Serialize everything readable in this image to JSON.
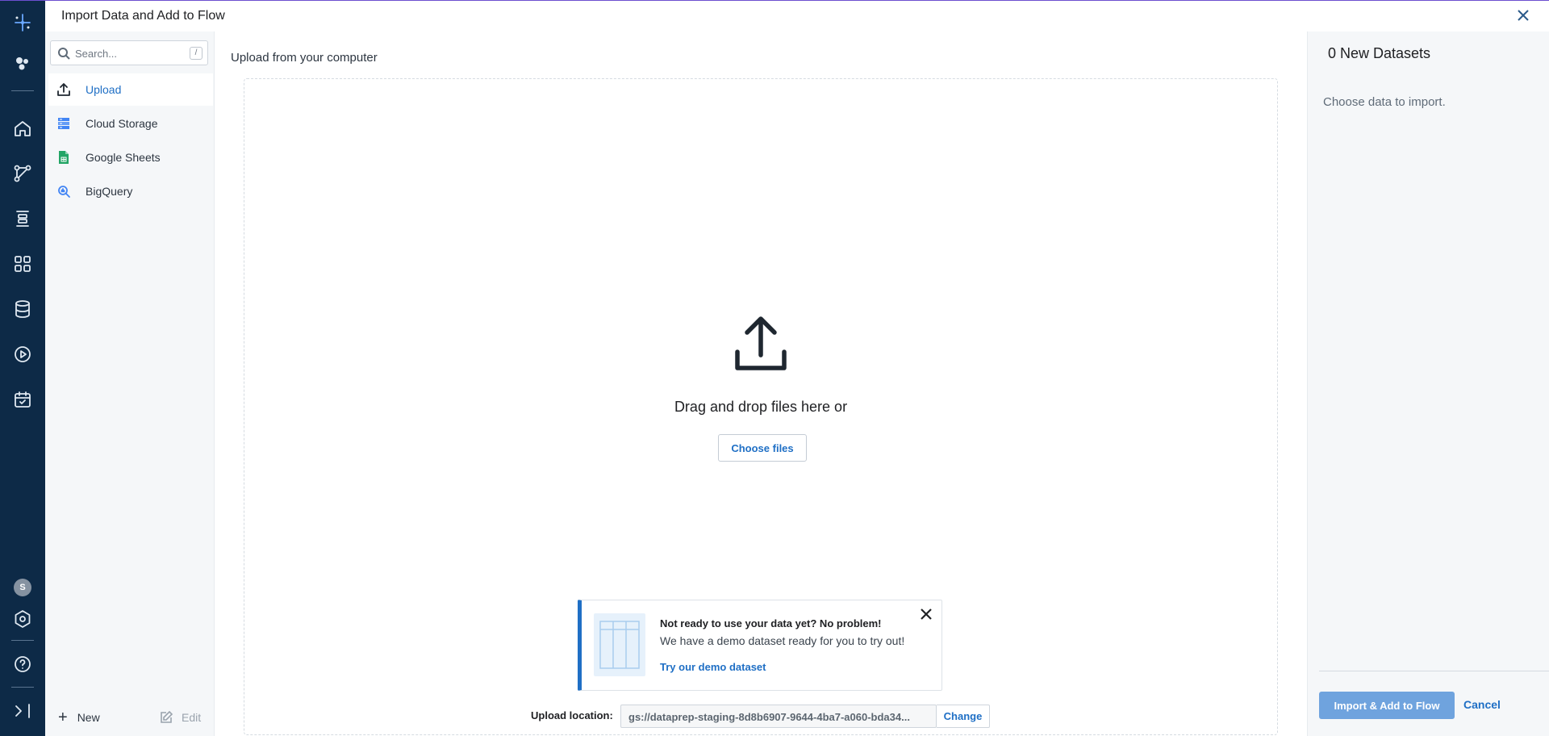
{
  "window": {
    "title": "Import Data and Add to Flow",
    "close_icon": "close-icon"
  },
  "rail": {
    "avatar_initial": "S",
    "icons": [
      "flows-logo-icon",
      "recipes-icon",
      "home-icon",
      "flows-icon",
      "plans-icon",
      "apps-icon",
      "datasets-icon",
      "jobs-icon",
      "schedules-icon",
      "settings-icon",
      "help-icon",
      "expand-icon"
    ]
  },
  "sidebar": {
    "search_placeholder": "Search...",
    "search_shortcut": "/",
    "items": [
      {
        "label": "Upload",
        "icon": "upload-icon",
        "active": true
      },
      {
        "label": "Cloud Storage",
        "icon": "cloud-storage-icon",
        "active": false
      },
      {
        "label": "Google Sheets",
        "icon": "google-sheets-icon",
        "active": false
      },
      {
        "label": "BigQuery",
        "icon": "bigquery-icon",
        "active": false
      }
    ],
    "new_label": "New",
    "edit_label": "Edit"
  },
  "main": {
    "heading": "Upload from your computer",
    "drag_text": "Drag and drop files here or",
    "choose_files": "Choose files",
    "demo": {
      "title": "Not ready to use your data yet? No problem!",
      "subtitle": "We have a demo dataset ready for you to try out!",
      "link": "Try our demo dataset"
    },
    "upload_location_label": "Upload location:",
    "upload_location_value": "gs://dataprep-staging-8d8b6907-9644-4ba7-a060-bda34...",
    "change_label": "Change"
  },
  "right_panel": {
    "title": "0 New Datasets",
    "empty_text": "Choose data to import.",
    "import_button": "Import & Add to Flow",
    "cancel_button": "Cancel"
  },
  "colors": {
    "rail_bg": "#0d2a47",
    "accent": "#1f6fc5",
    "panel_bg": "#f5f7f9",
    "import_button_bg": "#6fa3de"
  }
}
